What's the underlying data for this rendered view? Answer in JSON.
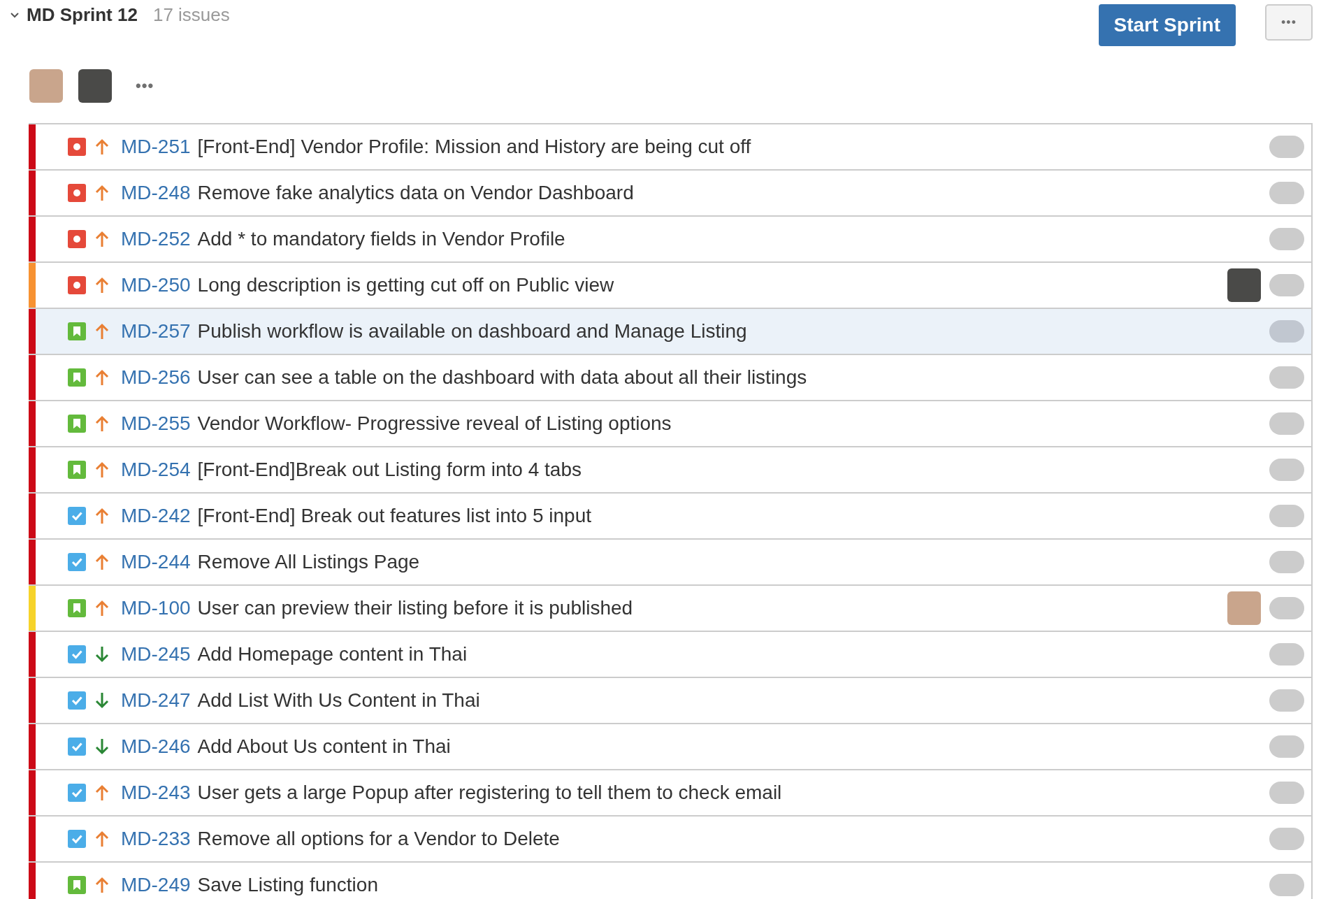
{
  "sprint": {
    "expanded": true,
    "title": "MD Sprint 12",
    "count": "17 issues",
    "start_button": "Start Sprint",
    "more_button": "•••",
    "participants_more": "•••"
  },
  "participants": [
    {
      "kind": "person"
    },
    {
      "kind": "pet"
    }
  ],
  "issues": [
    {
      "key": "MD-251",
      "summary": "[Front-End] Vendor Profile: Mission and History are being cut off",
      "kind": "bug",
      "raised": true,
      "color": "#cc0a17",
      "selected": false
    },
    {
      "key": "MD-248",
      "summary": "Remove fake analytics data on Vendor Dashboard",
      "kind": "bug",
      "raised": true,
      "color": "#cc0a17",
      "selected": false
    },
    {
      "key": "MD-252",
      "summary": "Add * to mandatory fields in Vendor Profile",
      "kind": "bug",
      "raised": true,
      "color": "#cc0a17",
      "selected": false
    },
    {
      "key": "MD-250",
      "summary": "Long description is getting cut off on Public view",
      "kind": "bug",
      "raised": true,
      "color": "#f79232",
      "assignee": {
        "kind": "pet"
      },
      "selected": false
    },
    {
      "key": "MD-257",
      "summary": "Publish workflow is available on dashboard and Manage Listing",
      "kind": "story",
      "raised": true,
      "color": "#cc0a17",
      "selected": true
    },
    {
      "key": "MD-256",
      "summary": "User can see a table on the dashboard with data about all their listings",
      "kind": "story",
      "raised": true,
      "color": "#cc0a17",
      "selected": false
    },
    {
      "key": "MD-255",
      "summary": "Vendor Workflow- Progressive reveal of Listing options",
      "kind": "story",
      "raised": true,
      "color": "#cc0a17",
      "selected": false
    },
    {
      "key": "MD-254",
      "summary": "[Front-End]Break out Listing form into 4 tabs",
      "kind": "story",
      "raised": true,
      "color": "#cc0a17",
      "selected": false
    },
    {
      "key": "MD-242",
      "summary": "[Front-End] Break out features list into 5 input",
      "kind": "task",
      "raised": true,
      "color": "#cc0a17",
      "selected": false
    },
    {
      "key": "MD-244",
      "summary": "Remove All Listings Page",
      "kind": "task",
      "raised": true,
      "color": "#cc0a17",
      "selected": false
    },
    {
      "key": "MD-100",
      "summary": "User can preview their listing before it is published",
      "kind": "story",
      "raised": true,
      "color": "#f6d32a",
      "assignee": {
        "kind": "person"
      },
      "selected": false
    },
    {
      "key": "MD-245",
      "summary": "Add Homepage content in Thai",
      "kind": "task",
      "raised": false,
      "color": "#cc0a17",
      "selected": false
    },
    {
      "key": "MD-247",
      "summary": "Add List With Us Content in Thai",
      "kind": "task",
      "raised": false,
      "color": "#cc0a17",
      "selected": false
    },
    {
      "key": "MD-246",
      "summary": "Add About Us content in Thai",
      "kind": "task",
      "raised": false,
      "color": "#cc0a17",
      "selected": false
    },
    {
      "key": "MD-243",
      "summary": "User gets a large Popup after registering to tell them to check email",
      "kind": "task",
      "raised": true,
      "color": "#cc0a17",
      "selected": false
    },
    {
      "key": "MD-233",
      "summary": "Remove all options for a Vendor to Delete",
      "kind": "task",
      "raised": true,
      "color": "#cc0a17",
      "selected": false
    },
    {
      "key": "MD-249",
      "summary": "Save Listing function",
      "kind": "story",
      "raised": true,
      "color": "#cc0a17",
      "selected": false
    }
  ]
}
